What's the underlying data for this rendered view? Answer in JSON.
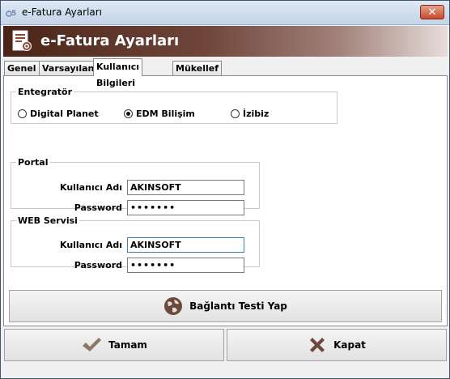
{
  "window": {
    "title": "e-Fatura Ayarları",
    "close_label": "✕"
  },
  "banner": {
    "title": "e-Fatura Ayarları"
  },
  "tabs": [
    {
      "label": "Genel"
    },
    {
      "label": "Varsayılan"
    },
    {
      "label": "Kullanıcı Bilgileri"
    },
    {
      "label": "Mükellef Listesi"
    }
  ],
  "active_tab": "Kullanıcı Bilgileri",
  "integrator": {
    "title": "Entegratör",
    "options": [
      {
        "label": "Digital Planet",
        "checked": false
      },
      {
        "label": "EDM Bilişim",
        "checked": true
      },
      {
        "label": "İzibiz",
        "checked": false
      }
    ]
  },
  "portal": {
    "title": "Portal",
    "username_label": "Kullanıcı Adı",
    "username_value": "AKINSOFT",
    "password_label": "Password",
    "password_value": "•••••••"
  },
  "web_service": {
    "title": "WEB Servisi",
    "username_label": "Kullanıcı Adı",
    "username_value": "AKINSOFT",
    "password_label": "Password",
    "password_value": "•••••••"
  },
  "test_button": {
    "label": "Bağlantı Testi Yap",
    "icon": "globe-icon"
  },
  "ok_button": {
    "label": "Tamam",
    "icon": "checkmark-icon"
  },
  "close_button": {
    "label": "Kapat",
    "icon": "x-icon"
  },
  "colors": {
    "banner_dark": "#4a2418",
    "check_color": "#8a7a62",
    "x_color": "#6b4a3c"
  }
}
